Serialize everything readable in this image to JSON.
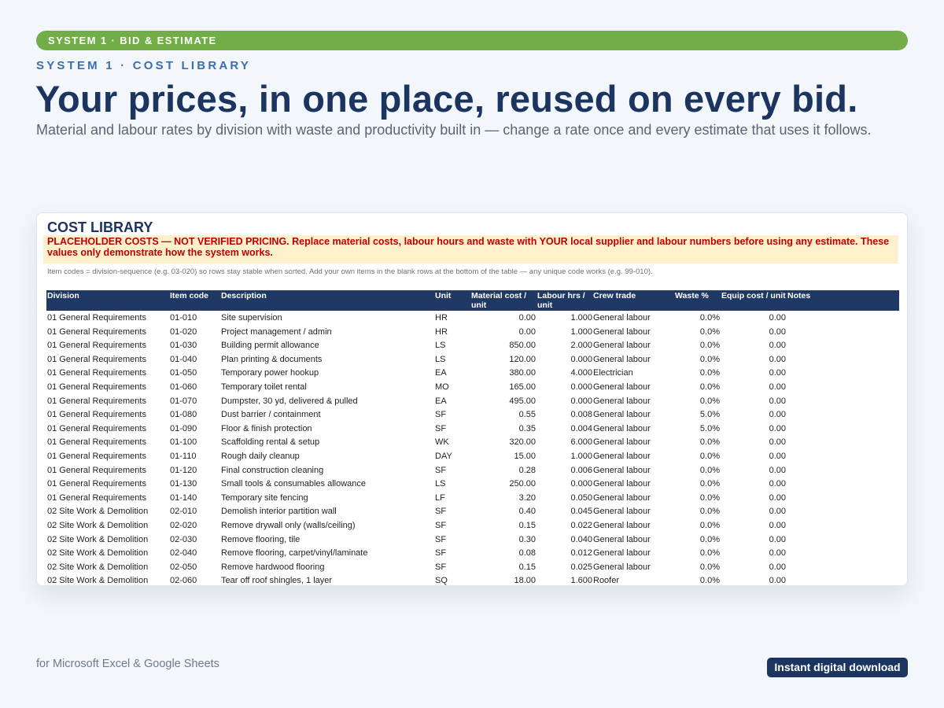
{
  "banner": {
    "label": "SYSTEM 1 · BID & ESTIMATE"
  },
  "eyebrow": "SYSTEM 1 · COST LIBRARY",
  "headline": "Your prices, in one place, reused on every bid.",
  "subhead": "Material and labour rates by division with waste and productivity built in — change a rate once and every estimate that uses it follows.",
  "sheet": {
    "title": "COST LIBRARY",
    "warning": "PLACEHOLDER COSTS — NOT VERIFIED PRICING.  Replace material costs, labour hours and waste with YOUR local supplier and labour numbers before using any estimate. These values only demonstrate how the system works.",
    "note": "Item codes = division-sequence (e.g. 03-020) so rows stay stable when sorted. Add your own items in the blank rows at the bottom of the table — any unique code works (e.g. 99-010).",
    "columns": [
      "Division",
      "Item code",
      "Description",
      "Unit",
      "Material cost / unit",
      "Labour hrs / unit",
      "Crew trade",
      "Waste %",
      "Equip cost / unit",
      "Notes"
    ],
    "rows": [
      [
        "01 General Requirements",
        "01-010",
        "Site supervision",
        "HR",
        "0.00",
        "1.000",
        "General labour",
        "0.0%",
        "0.00",
        ""
      ],
      [
        "01 General Requirements",
        "01-020",
        "Project management / admin",
        "HR",
        "0.00",
        "1.000",
        "General labour",
        "0.0%",
        "0.00",
        ""
      ],
      [
        "01 General Requirements",
        "01-030",
        "Building permit allowance",
        "LS",
        "850.00",
        "2.000",
        "General labour",
        "0.0%",
        "0.00",
        ""
      ],
      [
        "01 General Requirements",
        "01-040",
        "Plan printing & documents",
        "LS",
        "120.00",
        "0.000",
        "General labour",
        "0.0%",
        "0.00",
        ""
      ],
      [
        "01 General Requirements",
        "01-050",
        "Temporary power hookup",
        "EA",
        "380.00",
        "4.000",
        "Electrician",
        "0.0%",
        "0.00",
        ""
      ],
      [
        "01 General Requirements",
        "01-060",
        "Temporary toilet rental",
        "MO",
        "165.00",
        "0.000",
        "General labour",
        "0.0%",
        "0.00",
        ""
      ],
      [
        "01 General Requirements",
        "01-070",
        "Dumpster, 30 yd, delivered & pulled",
        "EA",
        "495.00",
        "0.000",
        "General labour",
        "0.0%",
        "0.00",
        ""
      ],
      [
        "01 General Requirements",
        "01-080",
        "Dust barrier / containment",
        "SF",
        "0.55",
        "0.008",
        "General labour",
        "5.0%",
        "0.00",
        ""
      ],
      [
        "01 General Requirements",
        "01-090",
        "Floor & finish protection",
        "SF",
        "0.35",
        "0.004",
        "General labour",
        "5.0%",
        "0.00",
        ""
      ],
      [
        "01 General Requirements",
        "01-100",
        "Scaffolding rental & setup",
        "WK",
        "320.00",
        "6.000",
        "General labour",
        "0.0%",
        "0.00",
        ""
      ],
      [
        "01 General Requirements",
        "01-110",
        "Rough daily cleanup",
        "DAY",
        "15.00",
        "1.000",
        "General labour",
        "0.0%",
        "0.00",
        ""
      ],
      [
        "01 General Requirements",
        "01-120",
        "Final construction cleaning",
        "SF",
        "0.28",
        "0.006",
        "General labour",
        "0.0%",
        "0.00",
        ""
      ],
      [
        "01 General Requirements",
        "01-130",
        "Small tools & consumables allowance",
        "LS",
        "250.00",
        "0.000",
        "General labour",
        "0.0%",
        "0.00",
        ""
      ],
      [
        "01 General Requirements",
        "01-140",
        "Temporary site fencing",
        "LF",
        "3.20",
        "0.050",
        "General labour",
        "0.0%",
        "0.00",
        ""
      ],
      [
        "02 Site Work & Demolition",
        "02-010",
        "Demolish interior partition wall",
        "SF",
        "0.40",
        "0.045",
        "General labour",
        "0.0%",
        "0.00",
        ""
      ],
      [
        "02 Site Work & Demolition",
        "02-020",
        "Remove drywall only (walls/ceiling)",
        "SF",
        "0.15",
        "0.022",
        "General labour",
        "0.0%",
        "0.00",
        ""
      ],
      [
        "02 Site Work & Demolition",
        "02-030",
        "Remove flooring, tile",
        "SF",
        "0.30",
        "0.040",
        "General labour",
        "0.0%",
        "0.00",
        ""
      ],
      [
        "02 Site Work & Demolition",
        "02-040",
        "Remove flooring, carpet/vinyl/laminate",
        "SF",
        "0.08",
        "0.012",
        "General labour",
        "0.0%",
        "0.00",
        ""
      ],
      [
        "02 Site Work & Demolition",
        "02-050",
        "Remove hardwood flooring",
        "SF",
        "0.15",
        "0.025",
        "General labour",
        "0.0%",
        "0.00",
        ""
      ],
      [
        "02 Site Work & Demolition",
        "02-060",
        "Tear off roof shingles, 1 layer",
        "SQ",
        "18.00",
        "1.600",
        "Roofer",
        "0.0%",
        "0.00",
        ""
      ]
    ]
  },
  "footer": {
    "platforms": "for Microsoft Excel & Google Sheets",
    "cta": "Instant digital download"
  },
  "colors": {
    "accent_green": "#72ad48",
    "navy": "#1b3460",
    "header_navy": "#1f3864",
    "warning_red": "#c00000",
    "warning_bg": "#fdf0cc"
  }
}
